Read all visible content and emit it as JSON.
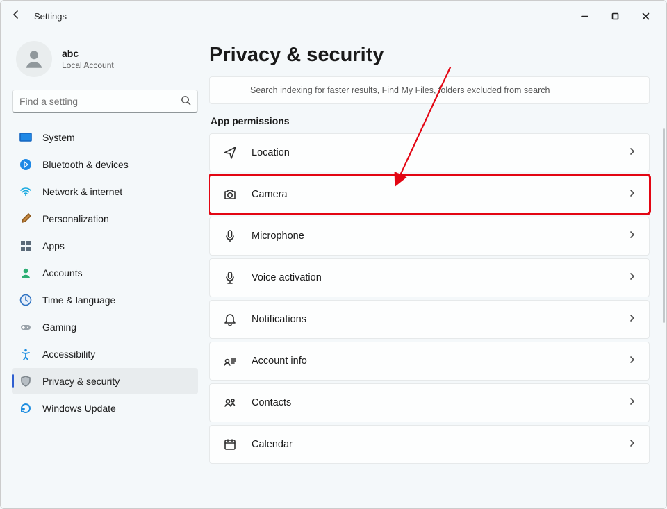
{
  "window": {
    "title": "Settings"
  },
  "user": {
    "name": "abc",
    "subtitle": "Local Account"
  },
  "search": {
    "placeholder": "Find a setting"
  },
  "nav": {
    "items": [
      {
        "id": "system",
        "label": "System"
      },
      {
        "id": "bluetooth",
        "label": "Bluetooth & devices"
      },
      {
        "id": "network",
        "label": "Network & internet"
      },
      {
        "id": "personalization",
        "label": "Personalization"
      },
      {
        "id": "apps",
        "label": "Apps"
      },
      {
        "id": "accounts",
        "label": "Accounts"
      },
      {
        "id": "time",
        "label": "Time & language"
      },
      {
        "id": "gaming",
        "label": "Gaming"
      },
      {
        "id": "accessibility",
        "label": "Accessibility"
      },
      {
        "id": "privacy",
        "label": "Privacy & security",
        "active": true
      },
      {
        "id": "update",
        "label": "Windows Update"
      }
    ]
  },
  "page": {
    "title": "Privacy & security",
    "search_card_subtitle": "Search indexing for faster results, Find My Files, folders excluded from search",
    "section_app_permissions": "App permissions",
    "rows": {
      "location": "Location",
      "camera": "Camera",
      "microphone": "Microphone",
      "voice": "Voice activation",
      "notifications": "Notifications",
      "account": "Account info",
      "contacts": "Contacts",
      "calendar": "Calendar"
    }
  },
  "annotation": {
    "highlight_row": "camera"
  }
}
